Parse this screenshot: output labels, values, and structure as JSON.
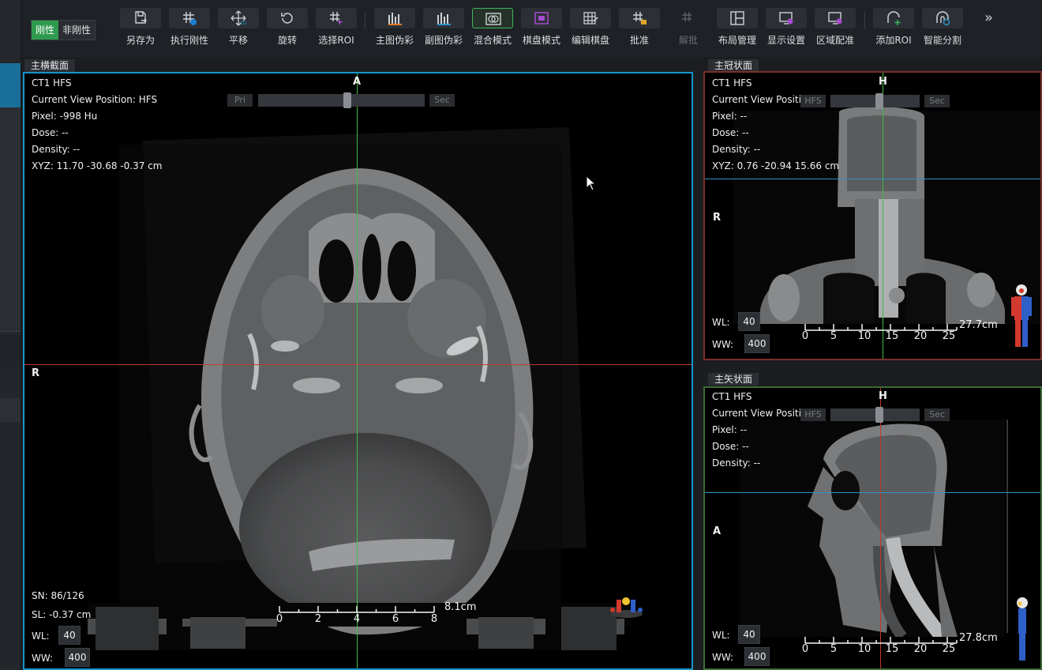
{
  "toolbar": {
    "mode_rigid": "刚性",
    "mode_nonrigid": "非刚性",
    "tools": [
      {
        "label": "另存为",
        "icon": "save-as-icon"
      },
      {
        "label": "执行刚性",
        "icon": "run-rigid-registration-icon"
      },
      {
        "label": "平移",
        "icon": "pan-move-icon"
      },
      {
        "label": "旋转",
        "icon": "rotate-icon"
      },
      {
        "label": "选择ROI",
        "icon": "select-roi-icon"
      },
      {
        "label": "主图伪彩",
        "icon": "primary-pseudocolor-icon"
      },
      {
        "label": "副图伪彩",
        "icon": "secondary-pseudocolor-icon"
      },
      {
        "label": "混合模式",
        "icon": "blend-mode-icon"
      },
      {
        "label": "棋盘模式",
        "icon": "checkerboard-mode-icon"
      },
      {
        "label": "编辑棋盘",
        "icon": "edit-checkerboard-icon"
      },
      {
        "label": "批准",
        "icon": "approve-icon"
      },
      {
        "label": "解批",
        "icon": "unapprove-icon"
      },
      {
        "label": "布局管理",
        "icon": "layout-icon"
      },
      {
        "label": "显示设置",
        "icon": "display-settings-icon"
      },
      {
        "label": "区域配准",
        "icon": "region-registration-icon"
      },
      {
        "label": "添加ROI",
        "icon": "add-roi-icon"
      },
      {
        "label": "智能分割",
        "icon": "smart-segment-icon"
      }
    ],
    "more": "»"
  },
  "axial": {
    "tab": "主横截面",
    "image_name": "CT1 HFS",
    "position": "Current View Position: HFS",
    "pixel": "Pixel:  -998 Hu",
    "dose": "Dose:  --",
    "density": "Density:  --",
    "xyz": "XYZ: 11.70 -30.68 -0.37 cm",
    "slider_pri": "Pri",
    "slider_sec": "Sec",
    "orient_top": "A",
    "orient_left": "R",
    "sn": "SN: 86/126",
    "sl": "SL: -0.37 cm",
    "wl_label": "WL:",
    "wl": "40",
    "ww_label": "WW:",
    "ww": "400",
    "scale_ticks": [
      "0",
      "2",
      "4",
      "6",
      "8"
    ],
    "scale_cm": "8.1cm"
  },
  "coronal": {
    "tab": "主冠状面",
    "image_name": "CT1 HFS",
    "position": "Current View Position:",
    "pixel": "Pixel:  --",
    "dose": "Dose:  --",
    "density": "Density:  --",
    "xyz": "XYZ: 0.76 -20.94 15.66 cm",
    "slider_pri": "HFS",
    "slider_sec": "Sec",
    "orient_top": "H",
    "orient_left": "R",
    "wl_label": "WL:",
    "wl": "40",
    "ww_label": "WW:",
    "ww": "400",
    "scale_ticks": [
      "0",
      "5",
      "10",
      "15",
      "20",
      "25"
    ],
    "scale_cm": "27.7cm"
  },
  "sagittal": {
    "tab": "主矢状面",
    "image_name": "CT1 HFS",
    "position": "Current View Position:",
    "pixel": "Pixel:  --",
    "dose": "Dose:  --",
    "density": "Density:  --",
    "slider_pri": "HFS",
    "slider_sec": "Sec",
    "orient_top": "H",
    "orient_left": "A",
    "wl_label": "WL:",
    "wl": "40",
    "ww_label": "WW:",
    "ww": "400",
    "scale_ticks": [
      "0",
      "5",
      "10",
      "15",
      "20",
      "25"
    ],
    "scale_cm": "27.8cm"
  },
  "colors": {
    "axial_border": "#1795c9",
    "coronal_border": "#7a3029",
    "sagittal_border": "#3c6b36",
    "crosshair_green": "#3cbf4a",
    "crosshair_red": "#c0392b",
    "crosshair_blue": "#2f93c8",
    "rigid_active": "#2f9b4f"
  }
}
